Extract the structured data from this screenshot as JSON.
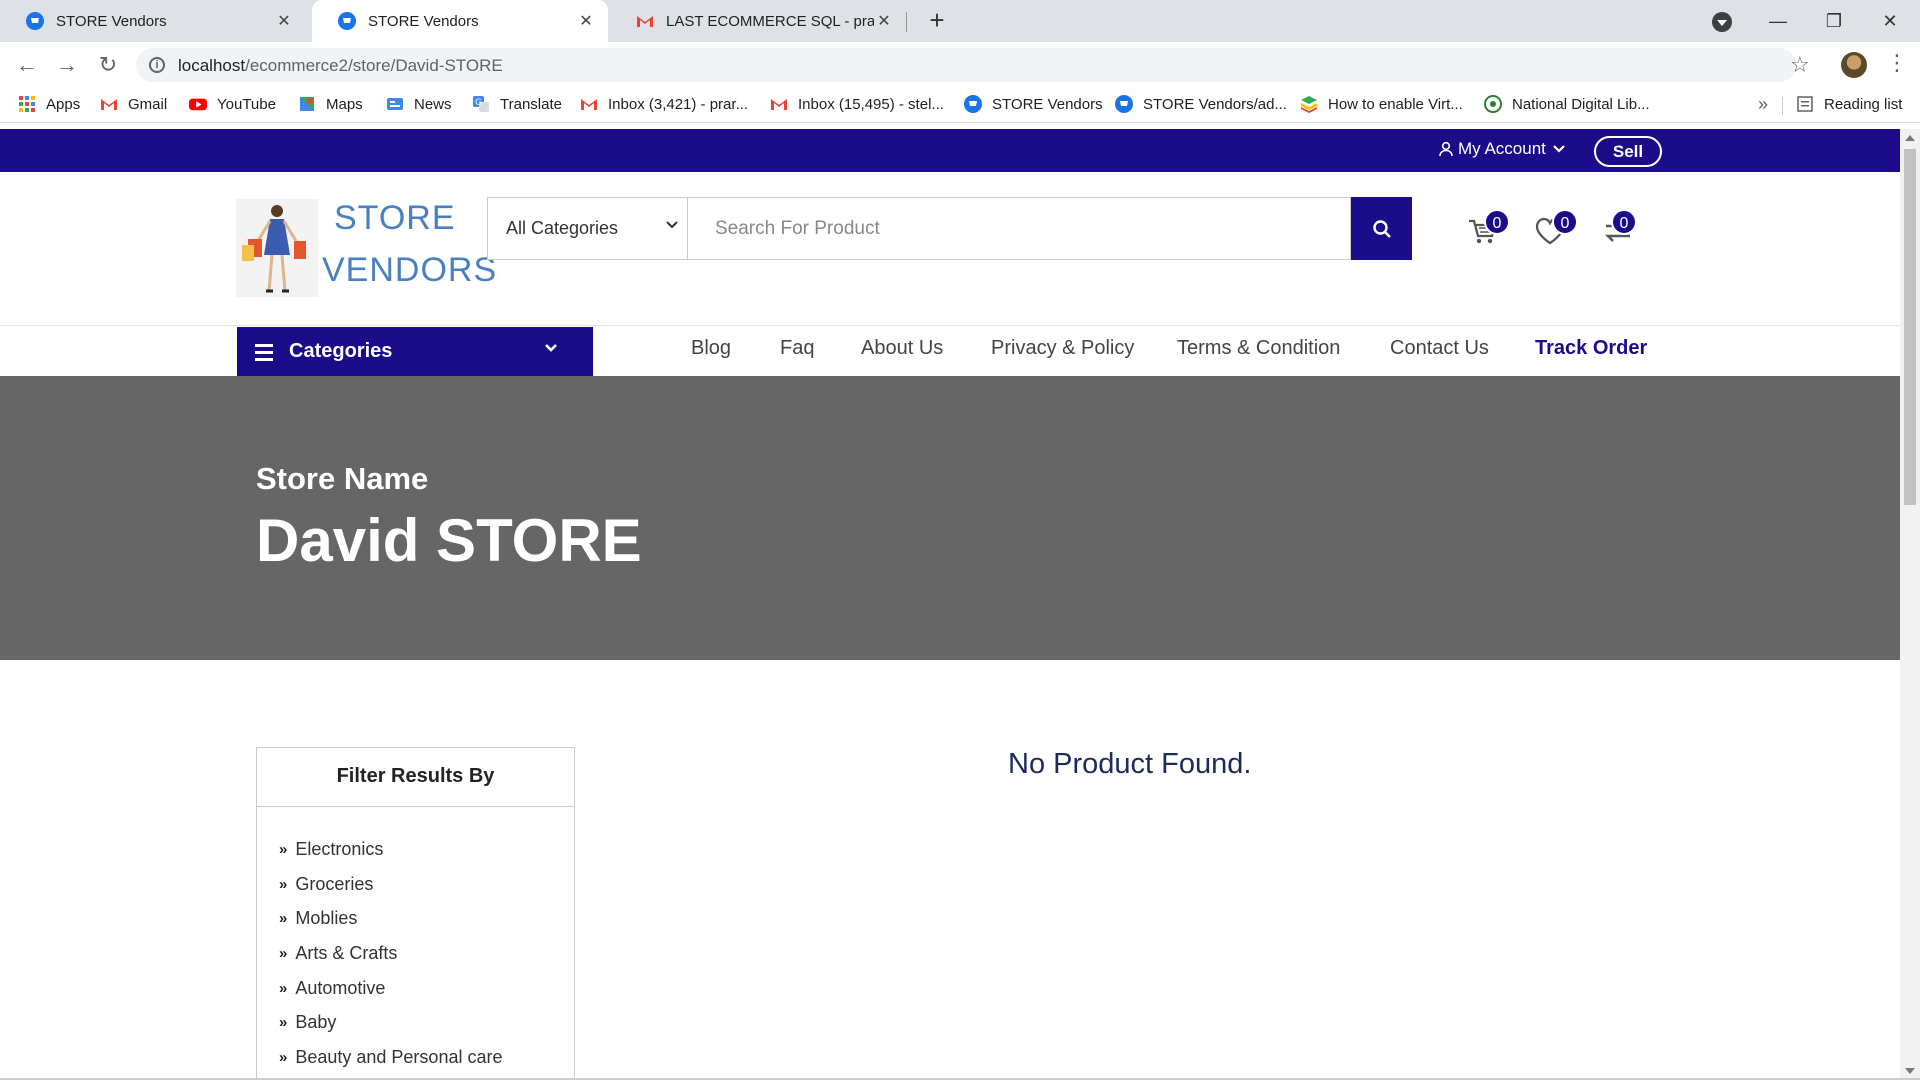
{
  "browser": {
    "tabs": [
      {
        "title": "STORE Vendors",
        "active": false
      },
      {
        "title": "STORE Vendors",
        "active": true
      },
      {
        "title": "LAST ECOMMERCE SQL - prartha",
        "active": false
      }
    ],
    "url_host": "localhost",
    "url_path": "/ecommerce2/store/David-STORE",
    "bookmarks": [
      {
        "label": "Apps",
        "icon": "apps-grid-icon"
      },
      {
        "label": "Gmail",
        "icon": "gmail-icon"
      },
      {
        "label": "YouTube",
        "icon": "youtube-icon"
      },
      {
        "label": "Maps",
        "icon": "maps-icon"
      },
      {
        "label": "News",
        "icon": "news-icon"
      },
      {
        "label": "Translate",
        "icon": "translate-icon"
      },
      {
        "label": "Inbox (3,421) - prar...",
        "icon": "gmail-icon"
      },
      {
        "label": "Inbox (15,495) - stel...",
        "icon": "gmail-icon"
      },
      {
        "label": "STORE Vendors",
        "icon": "store-favicon-icon"
      },
      {
        "label": "STORE Vendors/ad...",
        "icon": "store-favicon-icon"
      },
      {
        "label": "How to enable Virt...",
        "icon": "bluestacks-icon"
      },
      {
        "label": "National Digital Lib...",
        "icon": "ndl-icon"
      }
    ],
    "bookmarks_more": "»",
    "reading_list": "Reading list"
  },
  "site": {
    "topbar": {
      "my_account": "My Account",
      "sell": "Sell"
    },
    "logo": {
      "line1": "STORE",
      "line2": "VENDORS"
    },
    "search": {
      "category_selected": "All Categories",
      "placeholder": "Search For Product"
    },
    "counters": {
      "cart": "0",
      "wishlist": "0",
      "compare": "0"
    },
    "categories_label": "Categories",
    "menu": [
      "Blog",
      "Faq",
      "About Us",
      "Privacy & Policy",
      "Terms & Condition",
      "Contact Us",
      "Track Order"
    ],
    "banner": {
      "subtitle": "Store Name",
      "title": "David STORE"
    },
    "filter": {
      "title": "Filter Results By",
      "items": [
        "Electronics",
        "Groceries",
        "Moblies",
        "Arts & Crafts",
        "Automotive",
        "Baby",
        "Beauty and Personal care"
      ]
    },
    "no_product": "No Product Found."
  },
  "colors": {
    "brand": "#1b0d8a",
    "banner": "#666666",
    "logo_text": "#4a7fc1"
  }
}
